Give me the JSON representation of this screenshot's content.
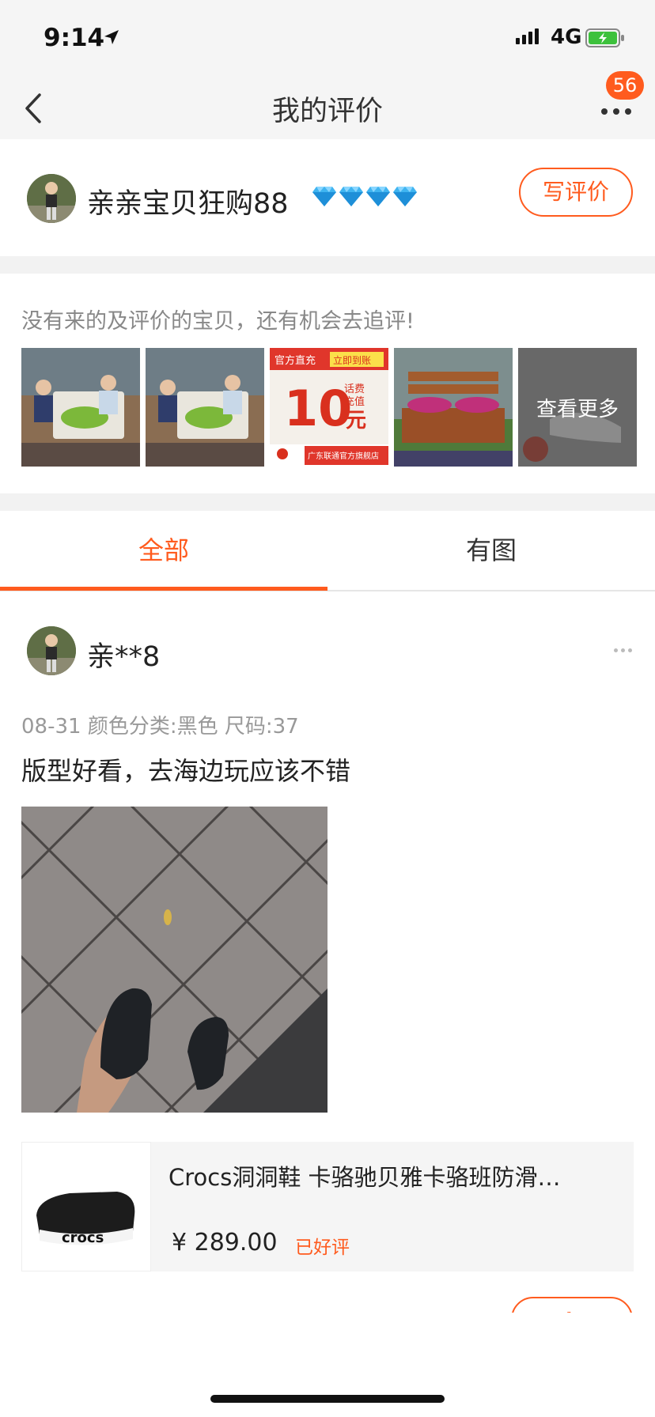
{
  "status_bar": {
    "time": "9:14",
    "network": "4G"
  },
  "nav": {
    "title": "我的评价",
    "badge": "56"
  },
  "profile": {
    "name": "亲亲宝贝狂购88",
    "write_review_label": "写评价"
  },
  "pending": {
    "hint": "没有来的及评价的宝贝，还有机会去追评!",
    "ad_top_left": "官方直充",
    "ad_top_right": "立即到账",
    "ad_amount": "10",
    "ad_unit": "元",
    "ad_tag_1": "话费",
    "ad_tag_2": "充值",
    "ad_shop": "广东联通官方旗舰店",
    "see_more_label": "查看更多"
  },
  "tabs": [
    {
      "label": "全部"
    },
    {
      "label": "有图"
    }
  ],
  "review": {
    "user": "亲**8",
    "meta": "08-31 颜色分类:黑色 尺码:37",
    "text": "版型好看，去海边玩应该不错",
    "product": {
      "title": "Crocs洞洞鞋 卡骆驰贝雅卡骆班防滑…",
      "price": "¥ 289.00",
      "status": "已好评",
      "brand": "crocs"
    }
  },
  "colors": {
    "accent": "#ff5b1e",
    "muted": "#999999",
    "background_gray": "#f2f2f2"
  },
  "icons": [
    "location-arrow-icon",
    "signal-icon",
    "battery-icon",
    "back-chevron-icon",
    "more-dots-icon",
    "diamond-icon",
    "edit-icon"
  ]
}
